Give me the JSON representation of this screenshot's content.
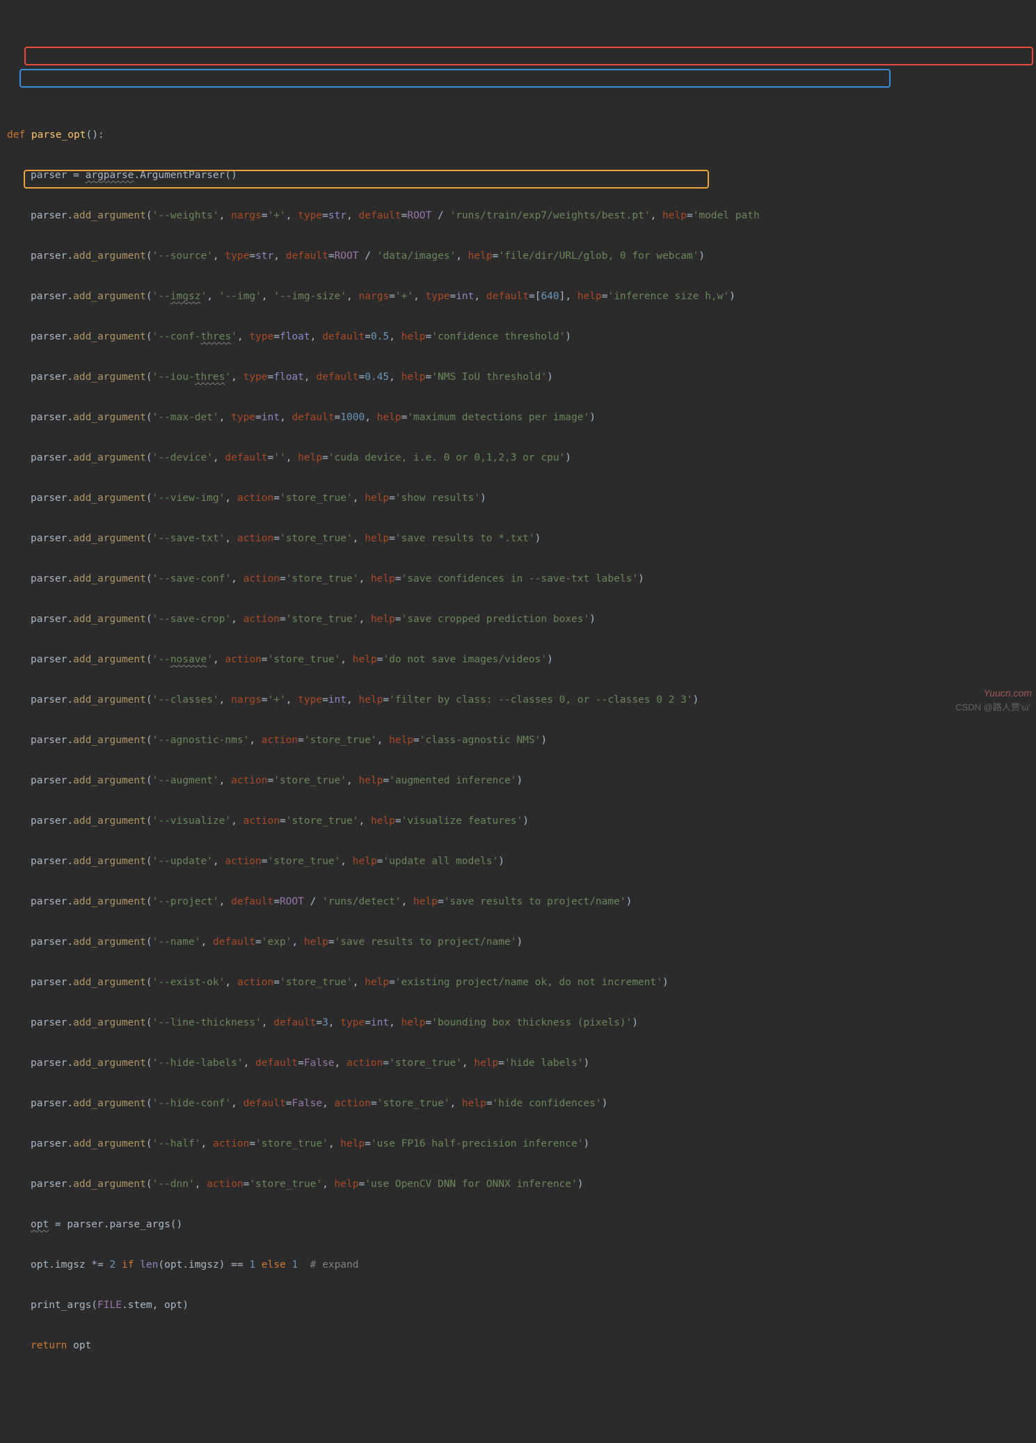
{
  "line01": {
    "def": "def ",
    "fn": "parse_opt",
    "rest": "():"
  },
  "line02": {
    "a": "parser = ",
    "b": "argparse",
    "c": ".ArgumentParser()"
  },
  "line03": {
    "pre": "parser.",
    "call": "add_argument",
    "op": "(",
    "arg": "'--weights'",
    "c1": ", ",
    "k_nargs": "nargs",
    "eq1": "=",
    "v_nargs": "'+'",
    "c2": ", ",
    "k_type": "type",
    "eq2": "=",
    "v_type": "str",
    "c3": ", ",
    "k_def": "default",
    "eq3": "=",
    "root": "ROOT",
    "slash": " / ",
    "path": "'runs/train/exp7/weights/best.pt'",
    "c4": ", ",
    "k_help": "help",
    "eq4": "=",
    "v_help": "'model path"
  },
  "line04": {
    "pre": "parser.",
    "call": "add_argument",
    "op": "(",
    "arg": "'--source'",
    "c1": ", ",
    "k_type": "type",
    "eq1": "=",
    "v_type": "str",
    "c2": ", ",
    "k_def": "default",
    "eq2": "=",
    "root": "ROOT",
    "slash": " / ",
    "path": "'data/images'",
    "c3": ", ",
    "k_help": "help",
    "eq3": "=",
    "v_help": "'file/dir/URL/glob, 0 for webcam'",
    "cp": ")"
  },
  "line05": {
    "pre": "parser.",
    "call": "add_argument",
    "op": "(",
    "a1": "'--imgsz'",
    "c1": ", ",
    "a2": "'--img'",
    "c2": ", ",
    "a3": "'--img-size'",
    "c3": ", ",
    "k_nargs": "nargs",
    "eq1": "=",
    "v_nargs": "'+'",
    "c4": ", ",
    "k_type": "type",
    "eq2": "=",
    "v_type": "int",
    "c5": ", ",
    "k_def": "default",
    "eq3": "=",
    "br1": "[",
    "num": "640",
    "br2": "]",
    "c6": ", ",
    "k_help": "help",
    "eq4": "=",
    "v_help": "'inference size h,w'",
    "cp": ")"
  },
  "line06": {
    "pre": "parser.",
    "call": "add_argument",
    "op": "(",
    "arg": "'--conf-thres'",
    "c1": ", ",
    "k_type": "type",
    "eq1": "=",
    "v_type": "float",
    "c2": ", ",
    "k_def": "default",
    "eq2": "=",
    "v_def": "0.5",
    "c3": ", ",
    "k_help": "help",
    "eq3": "=",
    "v_help": "'confidence threshold'",
    "cp": ")"
  },
  "line07": {
    "pre": "parser.",
    "call": "add_argument",
    "op": "(",
    "arg": "'--iou-thres'",
    "c1": ", ",
    "k_type": "type",
    "eq1": "=",
    "v_type": "float",
    "c2": ", ",
    "k_def": "default",
    "eq2": "=",
    "v_def": "0.45",
    "c3": ", ",
    "k_help": "help",
    "eq3": "=",
    "v_help": "'NMS IoU threshold'",
    "cp": ")"
  },
  "line08": {
    "pre": "parser.",
    "call": "add_argument",
    "op": "(",
    "arg": "'--max-det'",
    "c1": ", ",
    "k_type": "type",
    "eq1": "=",
    "v_type": "int",
    "c2": ", ",
    "k_def": "default",
    "eq2": "=",
    "v_def": "1000",
    "c3": ", ",
    "k_help": "help",
    "eq3": "=",
    "v_help": "'maximum detections per image'",
    "cp": ")"
  },
  "line09": {
    "pre": "parser.",
    "call": "add_argument",
    "op": "(",
    "arg": "'--device'",
    "c1": ", ",
    "k_def": "default",
    "eq1": "=",
    "v_def": "''",
    "c2": ", ",
    "k_help": "help",
    "eq2": "=",
    "v_help": "'cuda device, i.e. 0 or 0,1,2,3 or cpu'",
    "cp": ")"
  },
  "line10": {
    "pre": "parser.",
    "call": "add_argument",
    "op": "(",
    "arg": "'--view-img'",
    "c1": ", ",
    "k_ac": "action",
    "eq1": "=",
    "v_ac": "'store_true'",
    "c2": ", ",
    "k_help": "help",
    "eq2": "=",
    "v_help": "'show results'",
    "cp": ")"
  },
  "line11": {
    "pre": "parser.",
    "call": "add_argument",
    "op": "(",
    "arg": "'--save-txt'",
    "c1": ", ",
    "k_ac": "action",
    "eq1": "=",
    "v_ac": "'store_true'",
    "c2": ", ",
    "k_help": "help",
    "eq2": "=",
    "v_help": "'save results to *.txt'",
    "cp": ")"
  },
  "line12": {
    "pre": "parser.",
    "call": "add_argument",
    "op": "(",
    "arg": "'--save-conf'",
    "c1": ", ",
    "k_ac": "action",
    "eq1": "=",
    "v_ac": "'store_true'",
    "c2": ", ",
    "k_help": "help",
    "eq2": "=",
    "v_help": "'save confidences in --save-txt labels'",
    "cp": ")"
  },
  "line13": {
    "pre": "parser.",
    "call": "add_argument",
    "op": "(",
    "arg": "'--save-crop'",
    "c1": ", ",
    "k_ac": "action",
    "eq1": "=",
    "v_ac": "'store_true'",
    "c2": ", ",
    "k_help": "help",
    "eq2": "=",
    "v_help": "'save cropped prediction boxes'",
    "cp": ")"
  },
  "line14": {
    "pre": "parser.",
    "call": "add_argument",
    "op": "(",
    "arg1": "'--",
    "arg2": "nosave",
    "arg3": "'",
    "c1": ", ",
    "k_ac": "action",
    "eq1": "=",
    "v_ac": "'store_true'",
    "c2": ", ",
    "k_help": "help",
    "eq2": "=",
    "v_help": "'do not save images/videos'",
    "cp": ")"
  },
  "line15": {
    "pre": "parser.",
    "call": "add_argument",
    "op": "(",
    "arg": "'--classes'",
    "c1": ", ",
    "k_nargs": "nargs",
    "eq0": "=",
    "v_nargs": "'+'",
    "c0": ", ",
    "k_type": "type",
    "eq1": "=",
    "v_type": "int",
    "c2": ", ",
    "k_help": "help",
    "eq2": "=",
    "v_help": "'filter by class: --classes 0, or --classes 0 2 3'",
    "cp": ")"
  },
  "line16": {
    "pre": "parser.",
    "call": "add_argument",
    "op": "(",
    "arg": "'--agnostic-nms'",
    "c1": ", ",
    "k_ac": "action",
    "eq1": "=",
    "v_ac": "'store_true'",
    "c2": ", ",
    "k_help": "help",
    "eq2": "=",
    "v_help": "'class-agnostic NMS'",
    "cp": ")"
  },
  "line17": {
    "pre": "parser.",
    "call": "add_argument",
    "op": "(",
    "arg": "'--augment'",
    "c1": ", ",
    "k_ac": "action",
    "eq1": "=",
    "v_ac": "'store_true'",
    "c2": ", ",
    "k_help": "help",
    "eq2": "=",
    "v_help": "'augmented inference'",
    "cp": ")"
  },
  "line18": {
    "pre": "parser.",
    "call": "add_argument",
    "op": "(",
    "arg": "'--visualize'",
    "c1": ", ",
    "k_ac": "action",
    "eq1": "=",
    "v_ac": "'store_true'",
    "c2": ", ",
    "k_help": "help",
    "eq2": "=",
    "v_help": "'visualize features'",
    "cp": ")"
  },
  "line19": {
    "pre": "parser.",
    "call": "add_argument",
    "op": "(",
    "arg": "'--update'",
    "c1": ", ",
    "k_ac": "action",
    "eq1": "=",
    "v_ac": "'store_true'",
    "c2": ", ",
    "k_help": "help",
    "eq2": "=",
    "v_help": "'update all models'",
    "cp": ")"
  },
  "line20": {
    "pre": "parser.",
    "call": "add_argument",
    "op": "(",
    "arg": "'--project'",
    "c1": ", ",
    "k_def": "default",
    "eq1": "=",
    "root": "ROOT",
    "slash": " / ",
    "path": "'runs/detect'",
    "c2": ", ",
    "k_help": "help",
    "eq2": "=",
    "v_help": "'save results to project/name'",
    "cp": ")"
  },
  "line21": {
    "pre": "parser.",
    "call": "add_argument",
    "op": "(",
    "arg": "'--name'",
    "c1": ", ",
    "k_def": "default",
    "eq1": "=",
    "v_def": "'exp'",
    "c2": ", ",
    "k_help": "help",
    "eq2": "=",
    "v_help": "'save results to project/name'",
    "cp": ")"
  },
  "line22": {
    "pre": "parser.",
    "call": "add_argument",
    "op": "(",
    "arg": "'--exist-ok'",
    "c1": ", ",
    "k_ac": "action",
    "eq1": "=",
    "v_ac": "'store_true'",
    "c2": ", ",
    "k_help": "help",
    "eq2": "=",
    "v_help": "'existing project/name ok, do not increment'",
    "cp": ")"
  },
  "line23": {
    "pre": "parser.",
    "call": "add_argument",
    "op": "(",
    "arg": "'--line-thickness'",
    "c1": ", ",
    "k_def": "default",
    "eq1": "=",
    "v_def": "3",
    "c2": ", ",
    "k_type": "type",
    "eq2": "=",
    "v_type": "int",
    "c3": ", ",
    "k_help": "help",
    "eq3": "=",
    "v_help": "'bounding box thickness (pixels)'",
    "cp": ")"
  },
  "line24": {
    "pre": "parser.",
    "call": "add_argument",
    "op": "(",
    "arg": "'--hide-labels'",
    "c1": ", ",
    "k_def": "default",
    "eq1": "=",
    "v_def": "False",
    "c2": ", ",
    "k_ac": "action",
    "eq2": "=",
    "v_ac": "'store_true'",
    "c3": ", ",
    "k_help": "help",
    "eq3": "=",
    "v_help": "'hide labels'",
    "cp": ")"
  },
  "line25": {
    "pre": "parser.",
    "call": "add_argument",
    "op": "(",
    "arg": "'--hide-conf'",
    "c1": ", ",
    "k_def": "default",
    "eq1": "=",
    "v_def": "False",
    "c2": ", ",
    "k_ac": "action",
    "eq2": "=",
    "v_ac": "'store_true'",
    "c3": ", ",
    "k_help": "help",
    "eq3": "=",
    "v_help": "'hide confidences'",
    "cp": ")"
  },
  "line26": {
    "pre": "parser.",
    "call": "add_argument",
    "op": "(",
    "arg": "'--half'",
    "c1": ", ",
    "k_ac": "action",
    "eq1": "=",
    "v_ac": "'store_true'",
    "c2": ", ",
    "k_help": "help",
    "eq2": "=",
    "v_help": "'use FP16 half-precision inference'",
    "cp": ")"
  },
  "line27": {
    "pre": "parser.",
    "call": "add_argument",
    "op": "(",
    "arg": "'--dnn'",
    "c1": ", ",
    "k_ac": "action",
    "eq1": "=",
    "v_ac": "'store_true'",
    "c2": ", ",
    "k_help": "help",
    "eq2": "=",
    "v_help": "'use OpenCV DNN for ONNX inference'",
    "cp": ")"
  },
  "line28": {
    "a": "opt",
    "b": " = parser.parse_args()"
  },
  "line29": {
    "a": "opt.imgsz *= ",
    "n1": "2",
    "b": " ",
    "if": "if ",
    "len": "len",
    "c": "(opt.imgsz) == ",
    "n2": "1",
    "d": " ",
    "else": "else ",
    "n3": "1",
    "sp": "  ",
    "cmt": "# expand"
  },
  "line30": {
    "a": "print_args(",
    "f": "FILE",
    "b": ".stem, opt)"
  },
  "line31": {
    "ret": "return ",
    "v": "opt"
  },
  "thres": "thres",
  "imgsz": "imgsz",
  "watermarks": {
    "site": "Yuucn.com",
    "csdn": "CSDN @路人贾'ω'"
  }
}
